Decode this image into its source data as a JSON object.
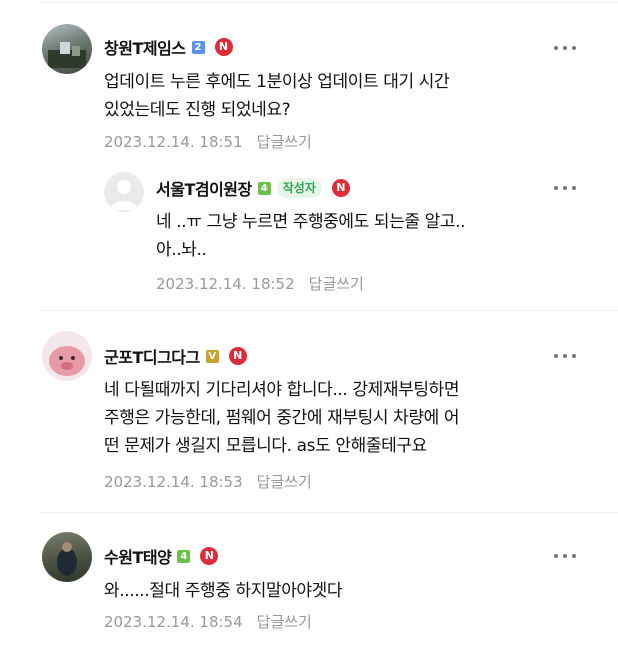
{
  "comments": [
    {
      "author": "창원T제임스",
      "level": "2",
      "lines": [
        "업데이트 누른 후에도 1분이상 업데이트 대기 시간",
        "있었는데도 진행 되었네요?"
      ],
      "date": "2023.12.14. 18:51",
      "reply_label": "답글쓰기"
    },
    {
      "author": "서울T겸이원장",
      "level": "4",
      "writer_badge": "작성자",
      "lines": [
        "네 ..ㅠ 그냥 누르면 주행중에도 되는줄 알고..",
        "아..놔.."
      ],
      "date": "2023.12.14. 18:52",
      "reply_label": "답글쓰기"
    },
    {
      "author": "군포T디그다그",
      "level": "V",
      "lines": [
        "네 다될때까지 기다리셔야 합니다... 강제재부팅하면",
        "주행은 가능한데, 펌웨어 중간에 재부팅시 차량에 어",
        "떤 문제가 생길지 모릅니다. as도 안해줄테구요"
      ],
      "date": "2023.12.14. 18:53",
      "reply_label": "답글쓰기"
    },
    {
      "author": "수원T태양",
      "level": "4",
      "lines": [
        "와......절대 주행중 하지말아야겟다"
      ],
      "date": "2023.12.14. 18:54",
      "reply_label": "답글쓰기"
    }
  ],
  "badges": {
    "n_label": "N"
  },
  "colors": {
    "level2": "#5b8ff0",
    "level4": "#6cc04a",
    "levelV": "#c9a227",
    "n_badge": "#e02b38",
    "meta": "#999999"
  }
}
